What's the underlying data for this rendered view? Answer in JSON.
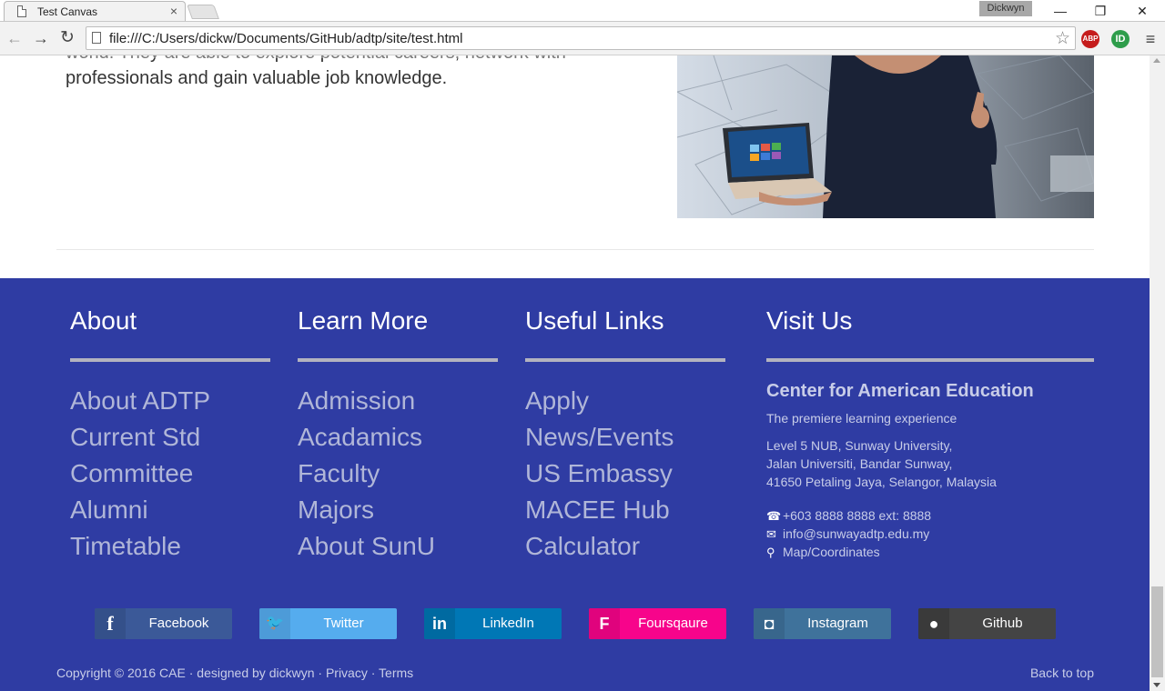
{
  "browser": {
    "tab_title": "Test Canvas",
    "tab_close": "×",
    "profile_name": "Dickwyn",
    "window": {
      "minimize": "—",
      "maximize": "❐",
      "close": "✕"
    },
    "nav": {
      "back": "←",
      "forward": "→",
      "reload": "↻"
    },
    "url": "file:///C:/Users/dickw/Documents/GitHub/adtp/site/test.html",
    "bookmark_star": "☆",
    "ext_abp": "ABP",
    "ext_id": "ID",
    "menu": "≡"
  },
  "content": {
    "intro_text": "world. They are able to explore potential careers, network with professionals and gain valuable job knowledge."
  },
  "footer": {
    "about": {
      "heading": "About",
      "links": [
        "About ADTP",
        "Current Std",
        "Committee",
        "Alumni",
        "Timetable"
      ]
    },
    "learn_more": {
      "heading": "Learn More",
      "links": [
        "Admission",
        "Acadamics",
        "Faculty",
        "Majors",
        "About SunU"
      ]
    },
    "useful_links": {
      "heading": "Useful Links",
      "links": [
        "Apply",
        "News/Events",
        "US Embassy",
        "MACEE Hub",
        "Calculator"
      ]
    },
    "visit": {
      "heading": "Visit Us",
      "org": "Center for American Education",
      "tagline": "The premiere learning experience",
      "address": [
        "Level 5 NUB, Sunway University,",
        "Jalan Universiti, Bandar Sunway,",
        "41650 Petaling Jaya, Selangor, Malaysia"
      ],
      "phone": "+603 8888 8888 ext: 8888",
      "email": "info@sunwayadtp.edu.my",
      "map": "Map/Coordinates"
    },
    "social": [
      {
        "label": "Facebook",
        "icon": "facebook-icon",
        "glyph": "f",
        "color": "#3b5998",
        "icon_bg": "#34508a"
      },
      {
        "label": "Twitter",
        "icon": "twitter-icon",
        "glyph": "🐦",
        "color": "#55acee",
        "icon_bg": "#4d9bd8"
      },
      {
        "label": "LinkedIn",
        "icon": "linkedin-icon",
        "glyph": "in",
        "color": "#0077b5",
        "icon_bg": "#006aa1"
      },
      {
        "label": "Foursqaure",
        "icon": "foursquare-icon",
        "glyph": "F",
        "color": "#f7048b",
        "icon_bg": "#e0037d"
      },
      {
        "label": "Instagram",
        "icon": "instagram-icon",
        "glyph": "◘",
        "color": "#3f729b",
        "icon_bg": "#38668c"
      },
      {
        "label": "Github",
        "icon": "github-icon",
        "glyph": "●",
        "color": "#444444",
        "icon_bg": "#3a3a3a"
      }
    ],
    "copyright": "Copyright © 2016 CAE",
    "designed_by": "designed by dickwyn",
    "privacy": "Privacy",
    "terms": "Terms",
    "separator": "·",
    "back_to_top": "Back to top"
  },
  "colors": {
    "footer_bg": "#2f3ca3",
    "footer_link": "#b0b6d8",
    "rule": "#b3b3bf"
  }
}
